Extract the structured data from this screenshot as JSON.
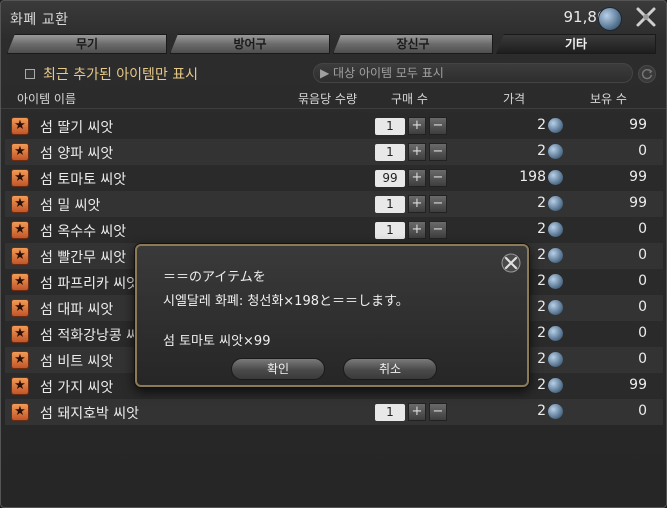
{
  "window": {
    "title": "화폐 교환",
    "currency_amount": "91,866"
  },
  "tabs": [
    {
      "label": "무기",
      "active": false
    },
    {
      "label": "방어구",
      "active": false
    },
    {
      "label": "장신구",
      "active": false
    },
    {
      "label": "기타",
      "active": true
    }
  ],
  "filter": {
    "recent_label": "최근 추가된 아이템만 표시",
    "show_all_label": "▶ 대상 아이템 모두 표시"
  },
  "columns": {
    "name": "아이템 이름",
    "bundle": "묶음당 수량",
    "purchase": "구매 수",
    "price": "가격",
    "owned": "보유 수"
  },
  "items": [
    {
      "name": "섬 딸기 씨앗",
      "qty": "1",
      "price": "2",
      "owned": "99"
    },
    {
      "name": "섬 양파 씨앗",
      "qty": "1",
      "price": "2",
      "owned": "0"
    },
    {
      "name": "섬 토마토 씨앗",
      "qty": "99",
      "price": "198",
      "owned": "99"
    },
    {
      "name": "섬 밀 씨앗",
      "qty": "1",
      "price": "2",
      "owned": "99"
    },
    {
      "name": "섬 옥수수 씨앗",
      "qty": "1",
      "price": "2",
      "owned": "0"
    },
    {
      "name": "섬 빨간무 씨앗",
      "qty": "",
      "price": "2",
      "owned": "0"
    },
    {
      "name": "섬 파프리카 씨앗",
      "qty": "",
      "price": "2",
      "owned": "0"
    },
    {
      "name": "섬 대파 씨앗",
      "qty": "",
      "price": "2",
      "owned": "0"
    },
    {
      "name": "섬 적화강낭콩 씨앗",
      "qty": "",
      "price": "2",
      "owned": "0"
    },
    {
      "name": "섬 비트 씨앗",
      "qty": "",
      "price": "2",
      "owned": "0"
    },
    {
      "name": "섬 가지 씨앗",
      "qty": "",
      "price": "2",
      "owned": "99"
    },
    {
      "name": "섬 돼지호박 씨앗",
      "qty": "1",
      "price": "2",
      "owned": "0"
    }
  ],
  "dialog": {
    "line1": "＝＝のアイテムを",
    "line2": "시엘달레 화폐: 청선화×198と＝＝します。",
    "line3": "섬 토마토 씨앗×99",
    "confirm_label": "확인",
    "cancel_label": "취소"
  },
  "icons": {
    "currency": "blue-gem-coin-icon",
    "settings": "crossed-tools-icon",
    "item": "star-icon",
    "refresh": "refresh-icon",
    "close": "close-icon"
  },
  "colors": {
    "accent_text": "#e7c98a",
    "dialog_border": "#8a7a55",
    "star": "#e07a3c"
  }
}
